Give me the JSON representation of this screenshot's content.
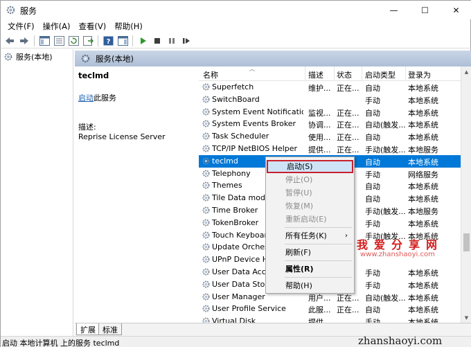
{
  "window": {
    "title": "服务"
  },
  "window_buttons": {
    "minimize": "—",
    "maximize": "☐",
    "close": "✕"
  },
  "menu": [
    "文件(F)",
    "操作(A)",
    "查看(V)",
    "帮助(H)"
  ],
  "tree": {
    "item": "服务(本地)"
  },
  "main_header": {
    "title": "服务(本地)"
  },
  "desc_pane": {
    "service_name": "teclmd",
    "start_link": "启动",
    "start_suffix": "此服务",
    "desc_label": "描述:",
    "desc_text": "Reprise License Server"
  },
  "columns": [
    "名称",
    "描述",
    "状态",
    "启动类型",
    "登录为"
  ],
  "rows": [
    {
      "name": "Superfetch",
      "desc": "维护...",
      "status": "正在...",
      "start": "自动",
      "logon": "本地系统"
    },
    {
      "name": "SwitchBoard",
      "desc": "",
      "status": "",
      "start": "手动",
      "logon": "本地系统"
    },
    {
      "name": "System Event Notification ...",
      "desc": "监视...",
      "status": "正在...",
      "start": "自动",
      "logon": "本地系统"
    },
    {
      "name": "System Events Broker",
      "desc": "协调...",
      "status": "正在...",
      "start": "自动(触发...",
      "logon": "本地系统"
    },
    {
      "name": "Task Scheduler",
      "desc": "使用...",
      "status": "正在...",
      "start": "自动",
      "logon": "本地系统"
    },
    {
      "name": "TCP/IP NetBIOS Helper",
      "desc": "提供...",
      "status": "正在...",
      "start": "手动(触发...",
      "logon": "本地服务"
    },
    {
      "name": "teclmd",
      "desc": "",
      "status": "",
      "start": "自动",
      "logon": "本地系统"
    },
    {
      "name": "Telephony",
      "desc": "",
      "status": "",
      "start": "手动",
      "logon": "网络服务"
    },
    {
      "name": "Themes",
      "desc": "",
      "status": "",
      "start": "自动",
      "logon": "本地系统"
    },
    {
      "name": "Tile Data model",
      "desc": "",
      "status": "",
      "start": "自动",
      "logon": "本地系统"
    },
    {
      "name": "Time Broker",
      "desc": "",
      "status": "",
      "start": "手动(触发...",
      "logon": "本地服务"
    },
    {
      "name": "TokenBroker",
      "desc": "",
      "status": "",
      "start": "手动",
      "logon": "本地系统"
    },
    {
      "name": "Touch Keyboard",
      "desc": "",
      "status": "",
      "start": "手动(触发...",
      "logon": "本地系统"
    },
    {
      "name": "Update Orchestr",
      "desc": "",
      "status": "",
      "start": "",
      "logon": ""
    },
    {
      "name": "UPnP Device Ho",
      "desc": "",
      "status": "",
      "start": "",
      "logon": ""
    },
    {
      "name": "User Data Access",
      "desc": "",
      "status": "",
      "start": "手动",
      "logon": "本地系统"
    },
    {
      "name": "User Data Storag",
      "desc": "",
      "status": "",
      "start": "手动",
      "logon": "本地系统"
    },
    {
      "name": "User Manager",
      "desc": "用户...",
      "status": "正在...",
      "start": "自动(触发...",
      "logon": "本地系统"
    },
    {
      "name": "User Profile Service",
      "desc": "此服...",
      "status": "正在...",
      "start": "自动",
      "logon": "本地系统"
    },
    {
      "name": "Virtual Disk",
      "desc": "提供...",
      "status": "",
      "start": "手动",
      "logon": "本地系统"
    }
  ],
  "context_menu": {
    "start": "启动(S)",
    "stop": "停止(O)",
    "pause": "暂停(U)",
    "resume": "恢复(M)",
    "restart": "重新启动(E)",
    "all_tasks": "所有任务(K)",
    "refresh": "刷新(F)",
    "properties": "属性(R)",
    "help": "帮助(H)"
  },
  "tabs": [
    "扩展",
    "标准"
  ],
  "status_bar": "启动 本地计算机 上的服务 teclmd",
  "watermark": {
    "cn": "我爱分享网",
    "url": "www.zhanshaoyi.com",
    "url2": "zhanshaoyi.com"
  },
  "colors": {
    "selected_row": "#0078d7",
    "header_band": "#b6c6dc",
    "context_highlight_border": "#c8202e"
  }
}
